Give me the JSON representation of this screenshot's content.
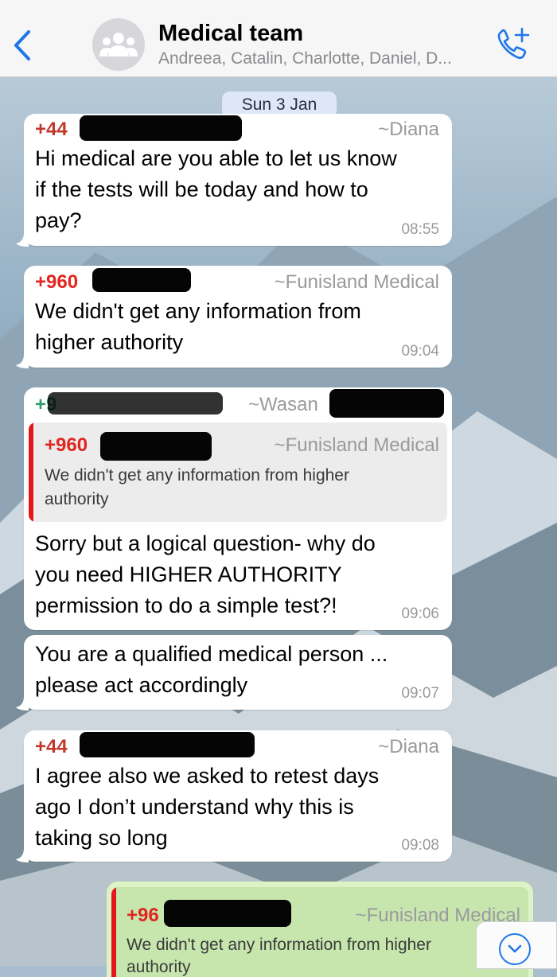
{
  "header": {
    "back_icon": "chevron-left-icon",
    "avatar_icon": "group-icon",
    "title": "Medical team",
    "subtitle": "Andreea, Catalin, Charlotte, Daniel, D...",
    "call_icon": "phone-plus-icon"
  },
  "date_chip": "Sun 3 Jan",
  "messages": [
    {
      "number": "+44",
      "sender": "~Diana",
      "lines": [
        "Hi medical are you able to let us know",
        "if the tests will be today and how to",
        "pay?"
      ],
      "time": "08:55",
      "number_color": "#c0392b"
    },
    {
      "number": "+960",
      "sender": "~Funisland Medical",
      "lines": [
        "We didn't get any information  from",
        "higher authority"
      ],
      "time": "09:04",
      "number_color": "#e0261f"
    },
    {
      "number": "+9",
      "sender": "~Wasan",
      "quote": {
        "number": "+960",
        "sender": "~Funisland Medical",
        "lines": [
          "We didn't get any information  from higher",
          "authority"
        ]
      },
      "lines": [
        "Sorry but a logical question- why do",
        "you need HIGHER AUTHORITY",
        "permission to do a simple test?!"
      ],
      "time": "09:06",
      "number_color": "#2e9a6f"
    },
    {
      "lines": [
        "You are a qualified medical person ...",
        "please act accordingly"
      ],
      "time": "09:07"
    },
    {
      "number": "+44",
      "sender": "~Diana",
      "lines": [
        "I agree also we asked to retest days",
        "ago I don’t understand why this is",
        "taking so long"
      ],
      "time": "09:08",
      "number_color": "#c0392b"
    },
    {
      "quote": {
        "number": "+96",
        "sender": "~Funisland Medical",
        "lines": [
          "We didn't get any information  from higher",
          "authority"
        ]
      }
    }
  ],
  "scroll_icon": "chevron-down-circle-icon",
  "colors": {
    "accent": "#1f77e6",
    "outgoing_bubble": "#dcf3c6",
    "quote_bar": "#e4161b"
  }
}
